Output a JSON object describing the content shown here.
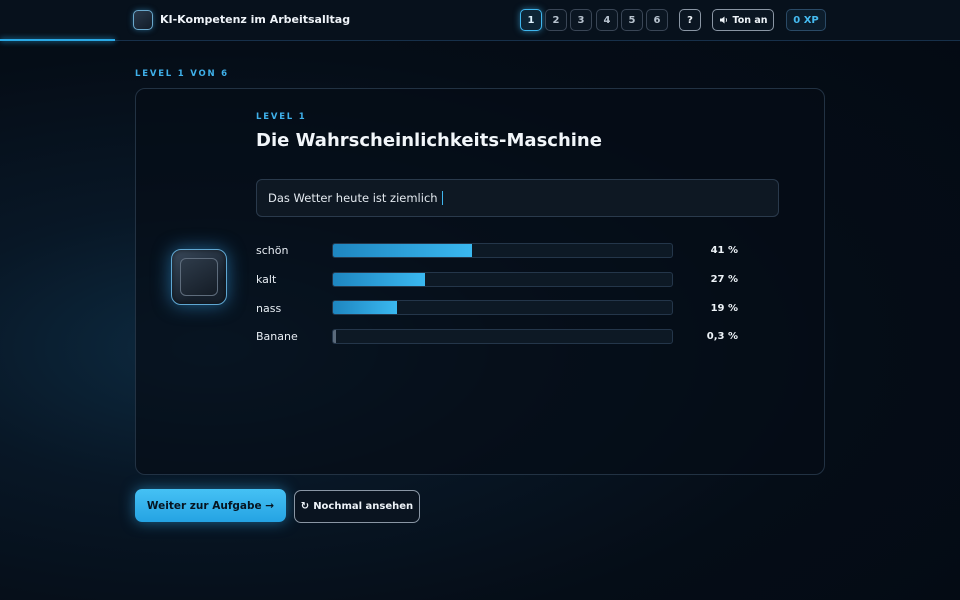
{
  "header": {
    "app_title": "KI-Kompetenz im Arbeitsalltag",
    "levels": [
      "1",
      "2",
      "3",
      "4",
      "5",
      "6"
    ],
    "active_level": "1",
    "help_label": "?",
    "sound_label": "Ton an",
    "xp_label": "0 XP",
    "progress_fraction": 0.12
  },
  "main": {
    "level_label": "LEVEL 1 VON 6",
    "card": {
      "sub_label": "LEVEL 1",
      "heading": "Die Wahrscheinlichkeits-Maschine",
      "prompt_text": "Das Wetter heute ist ziemlich",
      "predictions": [
        {
          "word": "schön",
          "percent_label": "41 %",
          "value": 41
        },
        {
          "word": "kalt",
          "percent_label": "27 %",
          "value": 27
        },
        {
          "word": "nass",
          "percent_label": "19 %",
          "value": 19
        },
        {
          "word": "Banane",
          "percent_label": "0,3 %",
          "value": 0.3
        }
      ]
    },
    "primary_button": "Weiter zur Aufgabe →",
    "secondary_button": "Nochmal ansehen",
    "secondary_icon": "↻"
  },
  "colors": {
    "accent": "#3fb6ee",
    "background": "#050d17",
    "bar_fill": "#2aa9e6",
    "bar_low": "#5b6b7c"
  },
  "icons": {
    "logo": "chip-logo-icon",
    "sound": "speaker-icon",
    "replay": "refresh-icon",
    "ai": "chip-icon"
  }
}
